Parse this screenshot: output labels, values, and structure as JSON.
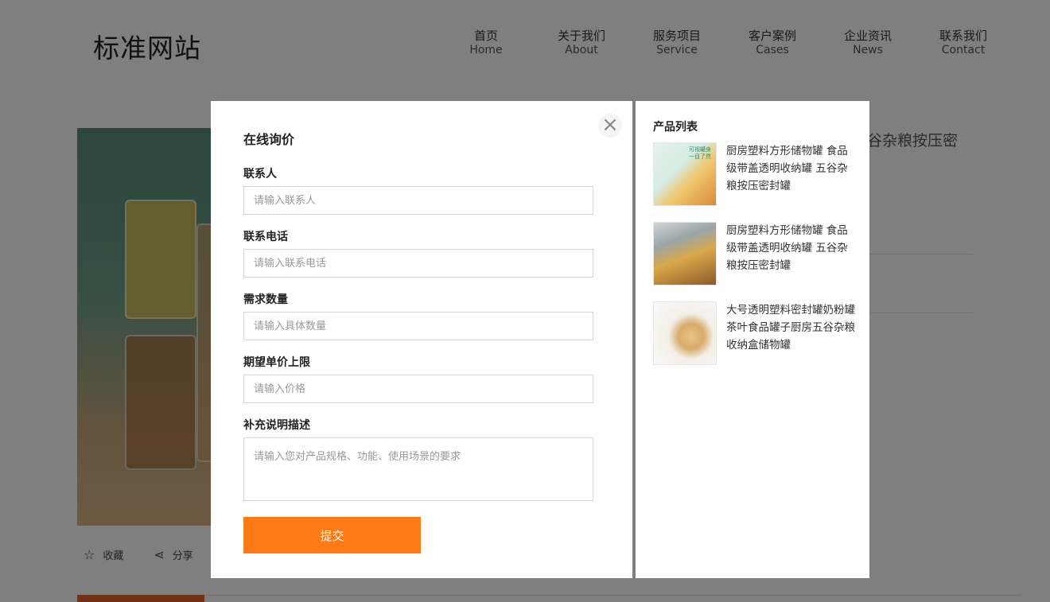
{
  "site": {
    "logo": "标准网站",
    "nav": [
      {
        "cn": "首页",
        "en": "Home"
      },
      {
        "cn": "关于我们",
        "en": "About"
      },
      {
        "cn": "服务项目",
        "en": "Service"
      },
      {
        "cn": "客户案例",
        "en": "Cases"
      },
      {
        "cn": "企业资讯",
        "en": "News"
      },
      {
        "cn": "联系我们",
        "en": "Contact"
      }
    ],
    "product_title_partial": "谷杂粮按压密",
    "actions": {
      "favorite": "收藏",
      "share": "分享"
    }
  },
  "modal": {
    "close_symbol": "×",
    "form": {
      "title": "在线询价",
      "fields": [
        {
          "label": "联系人",
          "placeholder": "请输入联系人"
        },
        {
          "label": "联系电话",
          "placeholder": "请输入联系电话"
        },
        {
          "label": "需求数量",
          "placeholder": "请输入具体数量"
        },
        {
          "label": "期望单价上限",
          "placeholder": "请输入价格"
        }
      ],
      "description": {
        "label": "补充说明描述",
        "placeholder": "请输入您对产品规格、功能、使用场景的要求"
      },
      "submit_label": "提交"
    },
    "product_list": {
      "title": "产品列表",
      "items": [
        {
          "name": "厨房塑料方形储物罐 食品级带盖透明收纳罐 五谷杂粮按压密封罐",
          "thumb_text": "可视罐身 一目了然"
        },
        {
          "name": "厨房塑料方形储物罐 食品级带盖透明收纳罐 五谷杂粮按压密封罐",
          "thumb_text": ""
        },
        {
          "name": "大号透明塑料密封罐奶粉罐茶叶食品罐子厨房五谷杂粮收纳盒储物罐",
          "thumb_text": ""
        }
      ]
    }
  },
  "colors": {
    "accent": "#ff7a16",
    "tab_active": "#e5632b"
  }
}
